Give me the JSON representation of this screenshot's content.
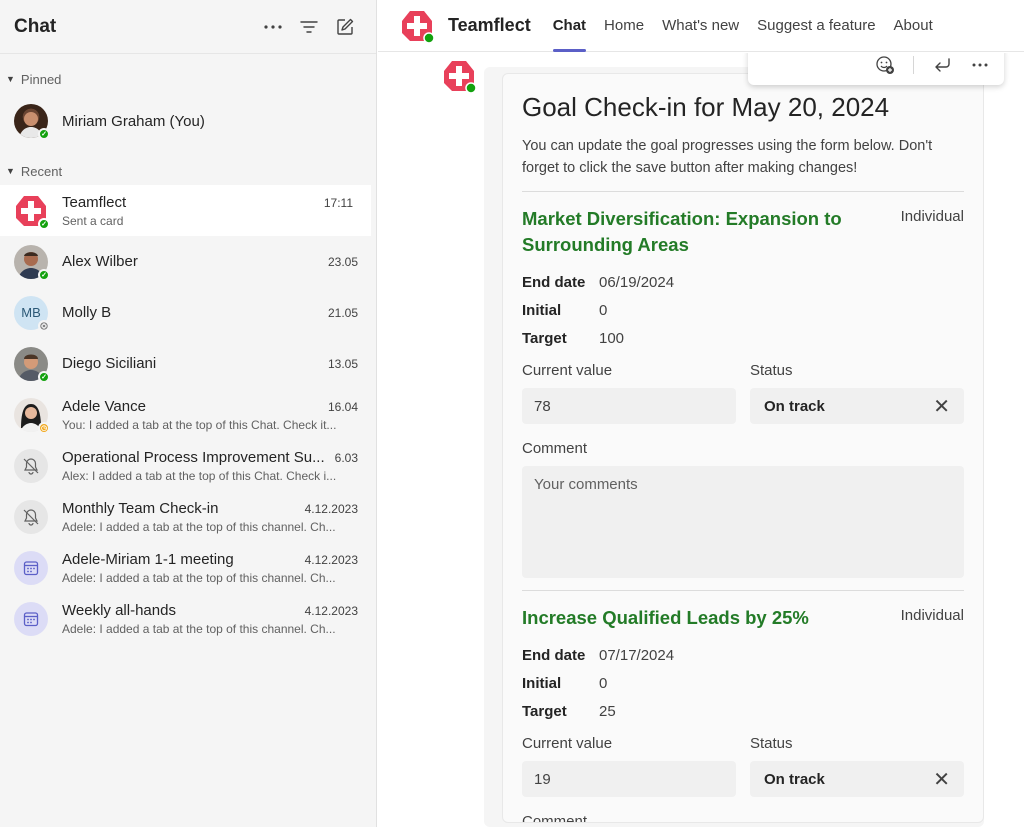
{
  "left": {
    "title": "Chat",
    "pinned_label": "Pinned",
    "recent_label": "Recent",
    "pinned": [
      {
        "name": "Miriam Graham (You)"
      }
    ],
    "recent": [
      {
        "name": "Teamflect",
        "time": "17:11",
        "preview": "Sent a card"
      },
      {
        "name": "Alex Wilber",
        "time": "23.05",
        "preview": ""
      },
      {
        "name": "Molly B",
        "time": "21.05",
        "preview": "",
        "initials": "MB"
      },
      {
        "name": "Diego Siciliani",
        "time": "13.05",
        "preview": ""
      },
      {
        "name": "Adele Vance",
        "time": "16.04",
        "preview": "You: I added a tab at the top of this Chat. Check it..."
      },
      {
        "name": "Operational Process Improvement Su...",
        "time": "6.03",
        "preview": "Alex: I added a tab at the top of this Chat. Check i..."
      },
      {
        "name": "Monthly Team Check-in",
        "time": "4.12.2023",
        "preview": "Adele: I added a tab at the top of this channel. Ch..."
      },
      {
        "name": "Adele-Miriam 1-1 meeting",
        "time": "4.12.2023",
        "preview": "Adele: I added a tab at the top of this channel. Ch..."
      },
      {
        "name": "Weekly all-hands",
        "time": "4.12.2023",
        "preview": "Adele: I added a tab at the top of this channel. Ch..."
      }
    ]
  },
  "topbar": {
    "app_name": "Teamflect",
    "tabs": [
      "Chat",
      "Home",
      "What's new",
      "Suggest a feature",
      "About"
    ]
  },
  "card": {
    "title": "Goal Check-in for May 20, 2024",
    "description": "You can update the goal progresses using the form below. Don't forget to click the save button after making changes!",
    "goals": [
      {
        "title": "Market Diversification: Expansion to Surrounding Areas",
        "type": "Individual",
        "end_date_label": "End date",
        "end_date": "06/19/2024",
        "initial_label": "Initial",
        "initial": "0",
        "target_label": "Target",
        "target": "100",
        "current_label": "Current value",
        "current": "78",
        "status_label": "Status",
        "status": "On track",
        "comment_label": "Comment",
        "comment_placeholder": "Your comments"
      },
      {
        "title": "Increase Qualified Leads by 25%",
        "type": "Individual",
        "end_date_label": "End date",
        "end_date": "07/17/2024",
        "initial_label": "Initial",
        "initial": "0",
        "target_label": "Target",
        "target": "25",
        "current_label": "Current value",
        "current": "19",
        "status_label": "Status",
        "status": "On track",
        "comment_label": "Comment",
        "comment_placeholder": ""
      }
    ]
  },
  "colors": {
    "accent": "#5b5fc7",
    "goal_title": "#237b27",
    "app_logo": "#e8405a",
    "presence_available": "#13a10e",
    "presence_away": "#f2a81d"
  }
}
